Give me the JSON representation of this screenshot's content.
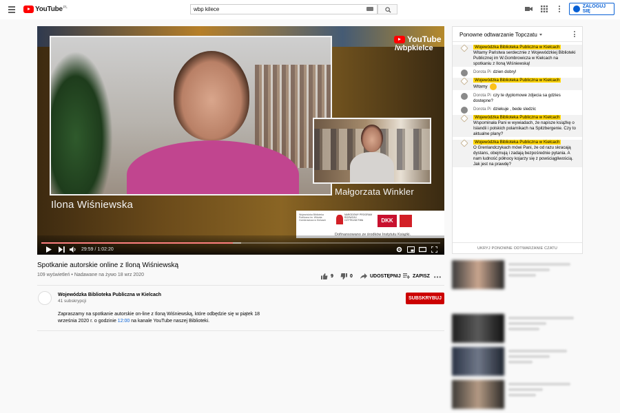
{
  "header": {
    "logo_text": "YouTube",
    "logo_region": "PL",
    "search_value": "wbp kilece",
    "signin_label": "ZALOGUJ SIĘ"
  },
  "player": {
    "time_current": "29:59",
    "time_total": "1:02:20",
    "time_separator": "/",
    "progress": 0.48,
    "buffered": 0.5,
    "overlay_brand": "YouTube",
    "overlay_handle": "/wbpkielce",
    "speaker_main": "Ilona Wiśniewska",
    "speaker_pip": "Małgorzata Winkler",
    "sponsor_text": "Dofinansowano ze środków Instytutu Książki.",
    "sponsor_logo1": "Wojewódzka Biblioteka Publiczna im. Witolda Gombrowicza w Kielcach",
    "sponsor_logo2": "NARODOWY PROGRAM ROZWOJU CZYTELNICTWA",
    "sponsor_logo3": "DKK"
  },
  "video": {
    "title": "Spotkanie autorskie online z Iloną Wiśniewską",
    "views": "109 wyświetleń",
    "streamed": "Nadawane na żywo 18 wrz 2020",
    "likes": "9",
    "dislikes": "0",
    "share_label": "UDOSTĘPNIJ",
    "save_label": "ZAPISZ"
  },
  "channel": {
    "name": "Wojewódzka Biblioteka Publiczna w Kielcach",
    "subs": "41 subskrypcji",
    "subscribe_label": "SUBSKRYBUJ",
    "description_part1": "Zapraszamy na spotkanie autorskie on-line z Iloną Wiśniewską, które odbędzie się w piątek 18 września 2020 r. o godzinie",
    "description_time": "12:00",
    "description_part2": "na kanale YouTube naszej Biblioteki."
  },
  "chat": {
    "header": "Ponowne odtwarzanie Topczatu",
    "footer": "UKRYJ PONOWNE ODTWARZANIE CZATU",
    "messages": [
      {
        "author": "Wojewódzka Biblioteka Publiczna w Kielcach",
        "owner": true,
        "text": "Witamy Państwa serdecznie z Wojewódzkiej Biblioteki Publicznej im W.Gombrowicza w Kielcach na spotkaniu z Iloną Wiśniewską!"
      },
      {
        "author": "Dorota Pi",
        "owner": false,
        "text": "dzien dobry!"
      },
      {
        "author": "Wojewódzka Biblioteka Publiczna w Kielcach",
        "owner": true,
        "text": "Witamy"
      },
      {
        "author": "Dorota Pi",
        "owner": false,
        "text": "czy te dyplomowe zdjecia sa gdzies dostepne?"
      },
      {
        "author": "Dorota Pi",
        "owner": false,
        "text": "dziekuje , bede sledzic"
      },
      {
        "author": "Wojewódzka Biblioteka Publiczna w Kielcach",
        "owner": true,
        "text": "Wspominała Pani w wywiadach, że napisze książkę o Islandii i polskich polarnikach na Spitzbergenie. Czy to aktualne plany?"
      },
      {
        "author": "Wojewódzka Biblioteka Publiczna w Kielcach",
        "owner": true,
        "text": "O Grenlandczykach mówi Pani, że od razu skracają dystans, obejmują i zadają bezpośrednie pytania. A nam ludność północy kojarzy się z powściągliwością. Jak jest na prawdę?"
      }
    ]
  },
  "colors": {
    "brand_red": "#ff0000",
    "subscribe_red": "#cc0000",
    "link_blue": "#065fd4",
    "owner_badge": "#ffd600"
  }
}
